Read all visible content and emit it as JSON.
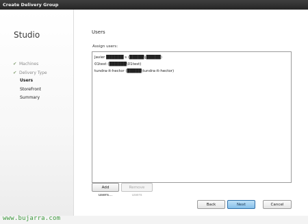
{
  "window": {
    "title": "Create Delivery Group"
  },
  "sidebar": {
    "brand": "Studio",
    "steps": [
      {
        "label": "Machines",
        "state": "done"
      },
      {
        "label": "Delivery Type",
        "state": "done"
      },
      {
        "label": "Users",
        "state": "current"
      },
      {
        "label": "StoreFront",
        "state": "pending"
      },
      {
        "label": "Summary",
        "state": "pending"
      }
    ]
  },
  "main": {
    "heading": "Users",
    "assign_label": "Assign users:",
    "users": [
      "Javier ██████ s (█████\\j█████)",
      "01test (██████\\01test)",
      "tundra-it-hector (█████\\tundra-it-hector)"
    ]
  },
  "buttons": {
    "add_users": "Add users...",
    "remove_users": "Remove users",
    "back": "Back",
    "next": "Next",
    "cancel": "Cancel"
  },
  "watermark": "www.bujarra.com",
  "colors": {
    "accent": "#86c0ea",
    "check": "#8aa37a",
    "watermark": "#3f9a3f"
  }
}
